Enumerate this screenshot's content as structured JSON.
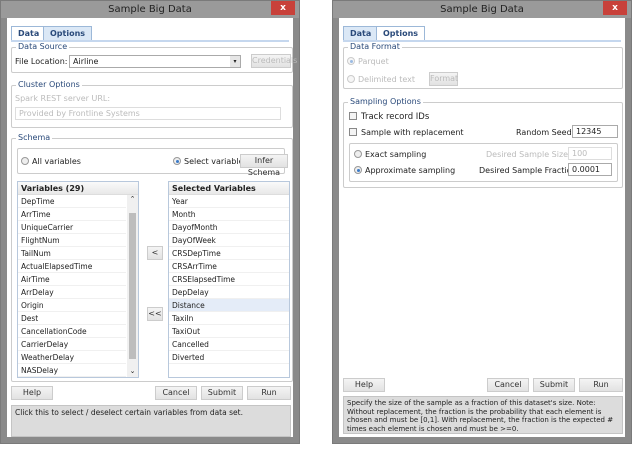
{
  "left": {
    "title": "Sample Big Data",
    "close": "x",
    "tabs": [
      "Data",
      "Options"
    ],
    "data_source": {
      "legend": "Data Source",
      "file_label": "File Location:",
      "file_value": "Airline",
      "credentials": "Credentials"
    },
    "cluster": {
      "legend": "Cluster Options",
      "url_label": "Spark REST server URL:",
      "url_placeholder": "Provided by Frontline Systems"
    },
    "schema": {
      "legend": "Schema",
      "all": "All variables",
      "select": "Select variables",
      "infer": "Infer Schema"
    },
    "variables_header": "Variables (29)",
    "variables": [
      "DepTime",
      "ArrTime",
      "UniqueCarrier",
      "FlightNum",
      "TailNum",
      "ActualElapsedTime",
      "AirTime",
      "ArrDelay",
      "Origin",
      "Dest",
      "CancellationCode",
      "CarrierDelay",
      "WeatherDelay",
      "NASDelay"
    ],
    "selected_header": "Selected Variables",
    "selected": [
      "Year",
      "Month",
      "DayofMonth",
      "DayOfWeek",
      "CRSDepTime",
      "CRSArrTime",
      "CRSElapsedTime",
      "DepDelay",
      "Distance",
      "TaxiIn",
      "TaxiOut",
      "Cancelled",
      "Diverted"
    ],
    "move_one": "<",
    "move_all": "<<",
    "help": "Help",
    "cancel": "Cancel",
    "submit": "Submit",
    "run": "Run",
    "help_text": "Click this to select / deselect certain variables from data set."
  },
  "right": {
    "title": "Sample Big Data",
    "close": "x",
    "tabs": [
      "Data",
      "Options"
    ],
    "format": {
      "legend": "Data Format",
      "parquet": "Parquet",
      "delimited": "Delimited text",
      "format_btn": "Format"
    },
    "sampling": {
      "legend": "Sampling Options",
      "track": "Track record IDs",
      "replacement": "Sample with replacement",
      "seed_label": "Random Seed:",
      "seed": "12345",
      "exact": "Exact sampling",
      "approx": "Approximate sampling",
      "size_label": "Desired Sample Size:",
      "size": "100",
      "fraction_label": "Desired Sample Fraction:",
      "fraction": "0.0001"
    },
    "help": "Help",
    "cancel": "Cancel",
    "submit": "Submit",
    "run": "Run",
    "help_text": "Specify the size of the sample as a fraction of this dataset's size. Note: Without replacement, the fraction is the probability that each element is chosen and must be [0,1]. With replacement, the fraction is the expected # times each element is chosen and must be >=0."
  }
}
